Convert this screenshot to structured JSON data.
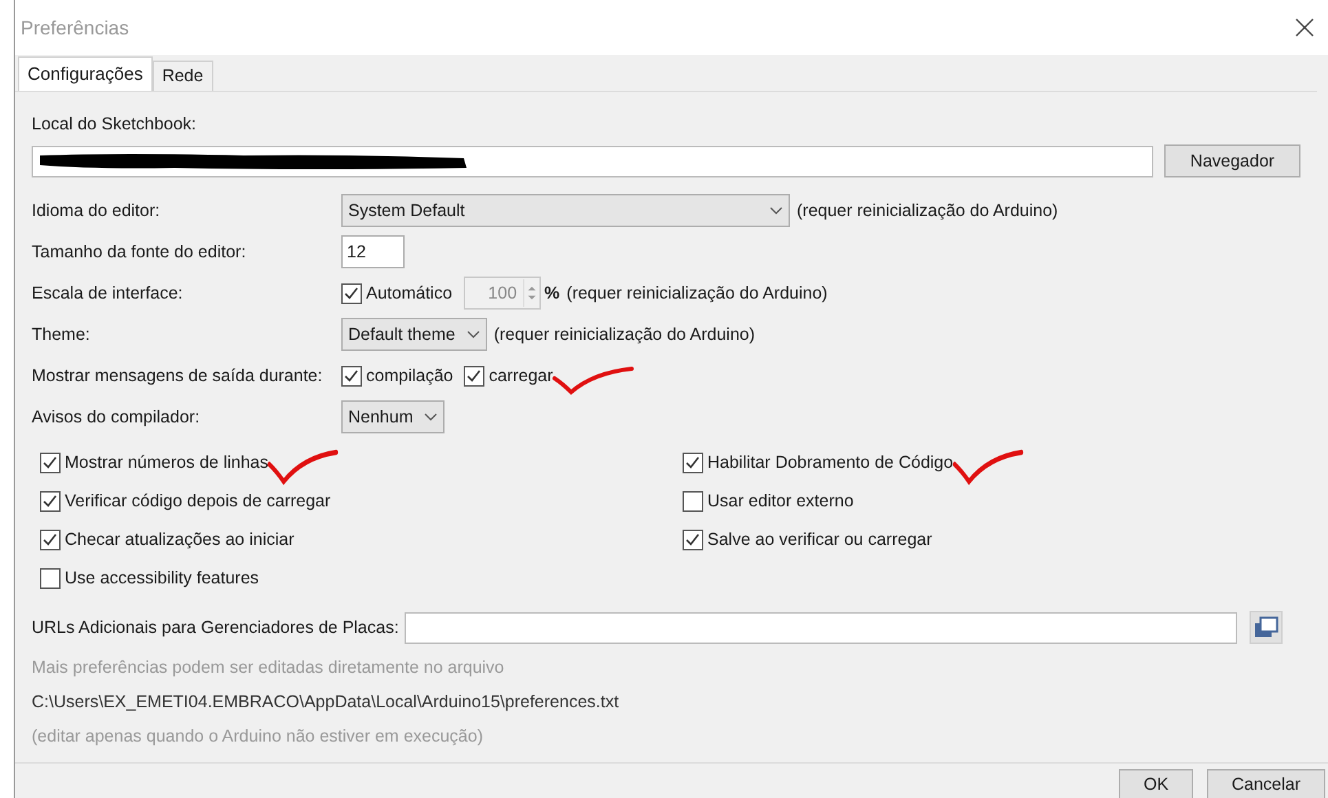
{
  "window": {
    "title": "Preferências"
  },
  "tabs": [
    {
      "label": "Configurações",
      "selected": true
    },
    {
      "label": "Rede",
      "selected": false
    }
  ],
  "sketchbook": {
    "label": "Local do Sketchbook:",
    "redacted": true,
    "button": "Navegador"
  },
  "settings": [
    {
      "kind": "select",
      "label": "Idioma do editor:",
      "value": "System Default",
      "wide": true,
      "note": "(requer reinicialização do Arduino)"
    },
    {
      "kind": "text",
      "label": "Tamanho da fonte do editor:",
      "value": "12"
    },
    {
      "kind": "scale",
      "label": "Escala de interface:",
      "auto_label": "Automático",
      "auto_checked": true,
      "value": "100",
      "disabled": true,
      "unit": "%",
      "note": "(requer reinicialização do Arduino)"
    },
    {
      "kind": "select",
      "label": "Theme:",
      "value": "Default theme",
      "wide": false,
      "note": "(requer reinicialização do Arduino)"
    },
    {
      "kind": "checks",
      "label": "Mostrar mensagens de saída durante:",
      "options": [
        {
          "label": "compilação",
          "checked": true,
          "annotated": false
        },
        {
          "label": "carregar",
          "checked": true,
          "annotated": true
        }
      ]
    },
    {
      "kind": "select",
      "label": "Avisos do compilador:",
      "value": "Nenhum",
      "wide": false
    }
  ],
  "options_left": [
    {
      "label": "Mostrar números de linhas",
      "checked": true,
      "annotated": true
    },
    {
      "label": "Verificar código depois de carregar",
      "checked": true,
      "annotated": false
    },
    {
      "label": "Checar atualizações ao iniciar",
      "checked": true,
      "annotated": false
    },
    {
      "label": "Use accessibility features",
      "checked": false,
      "annotated": false
    }
  ],
  "options_right": [
    {
      "label": "Habilitar Dobramento de Código",
      "checked": true,
      "annotated": true
    },
    {
      "label": "Usar editor externo",
      "checked": false,
      "annotated": false
    },
    {
      "label": "Salve ao verificar ou carregar",
      "checked": true,
      "annotated": false
    }
  ],
  "board_urls": {
    "label": "URLs Adicionais para Gerenciadores de Placas:"
  },
  "notes": [
    "Mais preferências podem ser editadas diretamente no arquivo",
    "C:\\Users\\EX_EMETI04.EMBRACO\\AppData\\Local\\Arduino15\\preferences.txt",
    "(editar apenas quando o Arduino não estiver em execução)"
  ],
  "buttons": [
    "OK",
    "Cancelar"
  ]
}
